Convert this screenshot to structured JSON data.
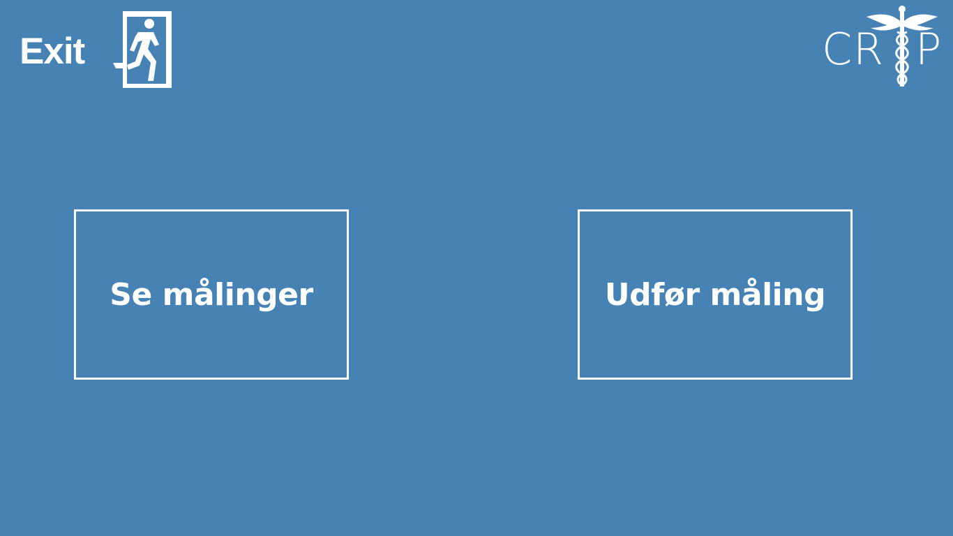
{
  "header": {
    "exit_label": "Exit",
    "exit_icon": "emergency-exit-icon",
    "logo_letters": [
      "C",
      "R",
      "P"
    ],
    "logo_icon": "caduceus-icon"
  },
  "menu": {
    "view_measurements_label": "Se målinger",
    "perform_measurement_label": "Udfør måling"
  },
  "colors": {
    "background": "#4682b4",
    "foreground": "#ffffff"
  }
}
